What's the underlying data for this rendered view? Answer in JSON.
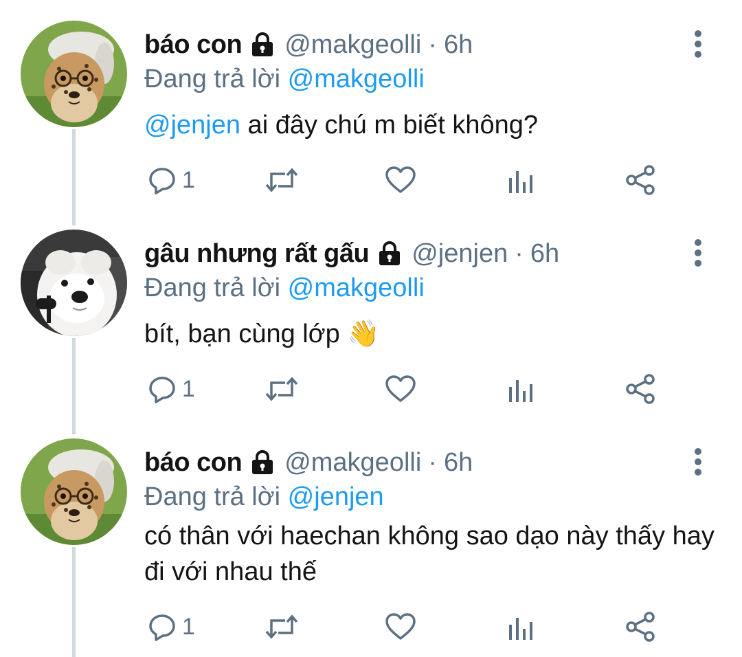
{
  "colors": {
    "text": "#141414",
    "secondary": "#5b7083",
    "mention": "#1d9bf0",
    "thread_line": "#cfd9de"
  },
  "tweets": [
    {
      "display_name": "báo con",
      "handle": "@makgeolli",
      "separator": "·",
      "time": "6h",
      "reply_prefix": "Đang trả lời",
      "reply_to": "@makgeolli",
      "text_mention": "@jenjen",
      "text": " ai đây chú m biết không?",
      "reply_count": "1",
      "avatar": "cheetah-avatar",
      "lock_icon": "lock-icon"
    },
    {
      "display_name": "gâu nhưng rất gấu",
      "handle": "@jenjen",
      "separator": "·",
      "time": "6h",
      "reply_prefix": "Đang trả lời",
      "reply_to": "@makgeolli",
      "text": "bít, bạn cùng lớp 👋",
      "reply_count": "1",
      "avatar": "dog-avatar",
      "lock_icon": "lock-icon"
    },
    {
      "display_name": "báo con",
      "handle": "@makgeolli",
      "separator": "·",
      "time": "6h",
      "reply_prefix": "Đang trả lời",
      "reply_to": "@jenjen",
      "text": "có thân với haechan không sao dạo này thấy hay đi với nhau thế",
      "reply_count": "1",
      "avatar": "cheetah-avatar",
      "lock_icon": "lock-icon"
    }
  ],
  "icons": {
    "reply": "reply-icon",
    "retweet": "retweet-icon",
    "like": "heart-icon",
    "analytics": "analytics-icon",
    "share": "share-icon",
    "more": "more-vertical-icon"
  }
}
